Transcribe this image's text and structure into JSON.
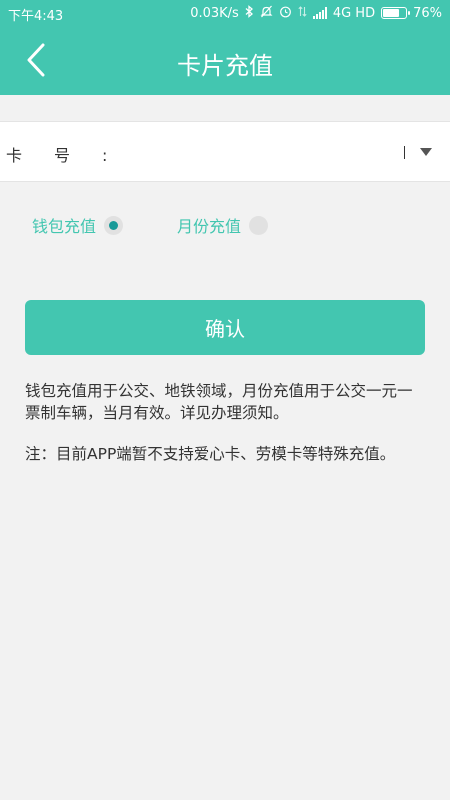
{
  "status_bar": {
    "time": "下午4:43",
    "network_speed": "0.03K/s",
    "network_type": "4G HD",
    "battery_text": "76%",
    "battery_level": 0.76,
    "icons": [
      "bluetooth-icon",
      "mute-icon",
      "alarm-icon",
      "data-transfer-icon",
      "signal-icon",
      "battery-icon"
    ]
  },
  "header": {
    "title": "卡片充值",
    "back_icon": "chevron-left-icon"
  },
  "card_field": {
    "label": "卡号:",
    "value": "",
    "dropdown_icon": "triangle-down-icon"
  },
  "recharge_type": {
    "options": [
      {
        "label": "钱包充值",
        "selected": true
      },
      {
        "label": "月份充值",
        "selected": false
      }
    ]
  },
  "confirm_button": {
    "label": "确认"
  },
  "notes": {
    "description": "钱包充值用于公交、地铁领域，月份充值用于公交一元一票制车辆，当月有效。详见办理须知。",
    "notice": "注：目前APP端暂不支持爱心卡、劳模卡等特殊充值。"
  },
  "colors": {
    "primary": "#43c6b0",
    "radio_checked": "#199a98",
    "radio_unchecked": "#e1e1e1",
    "background": "#f2f2f2"
  }
}
